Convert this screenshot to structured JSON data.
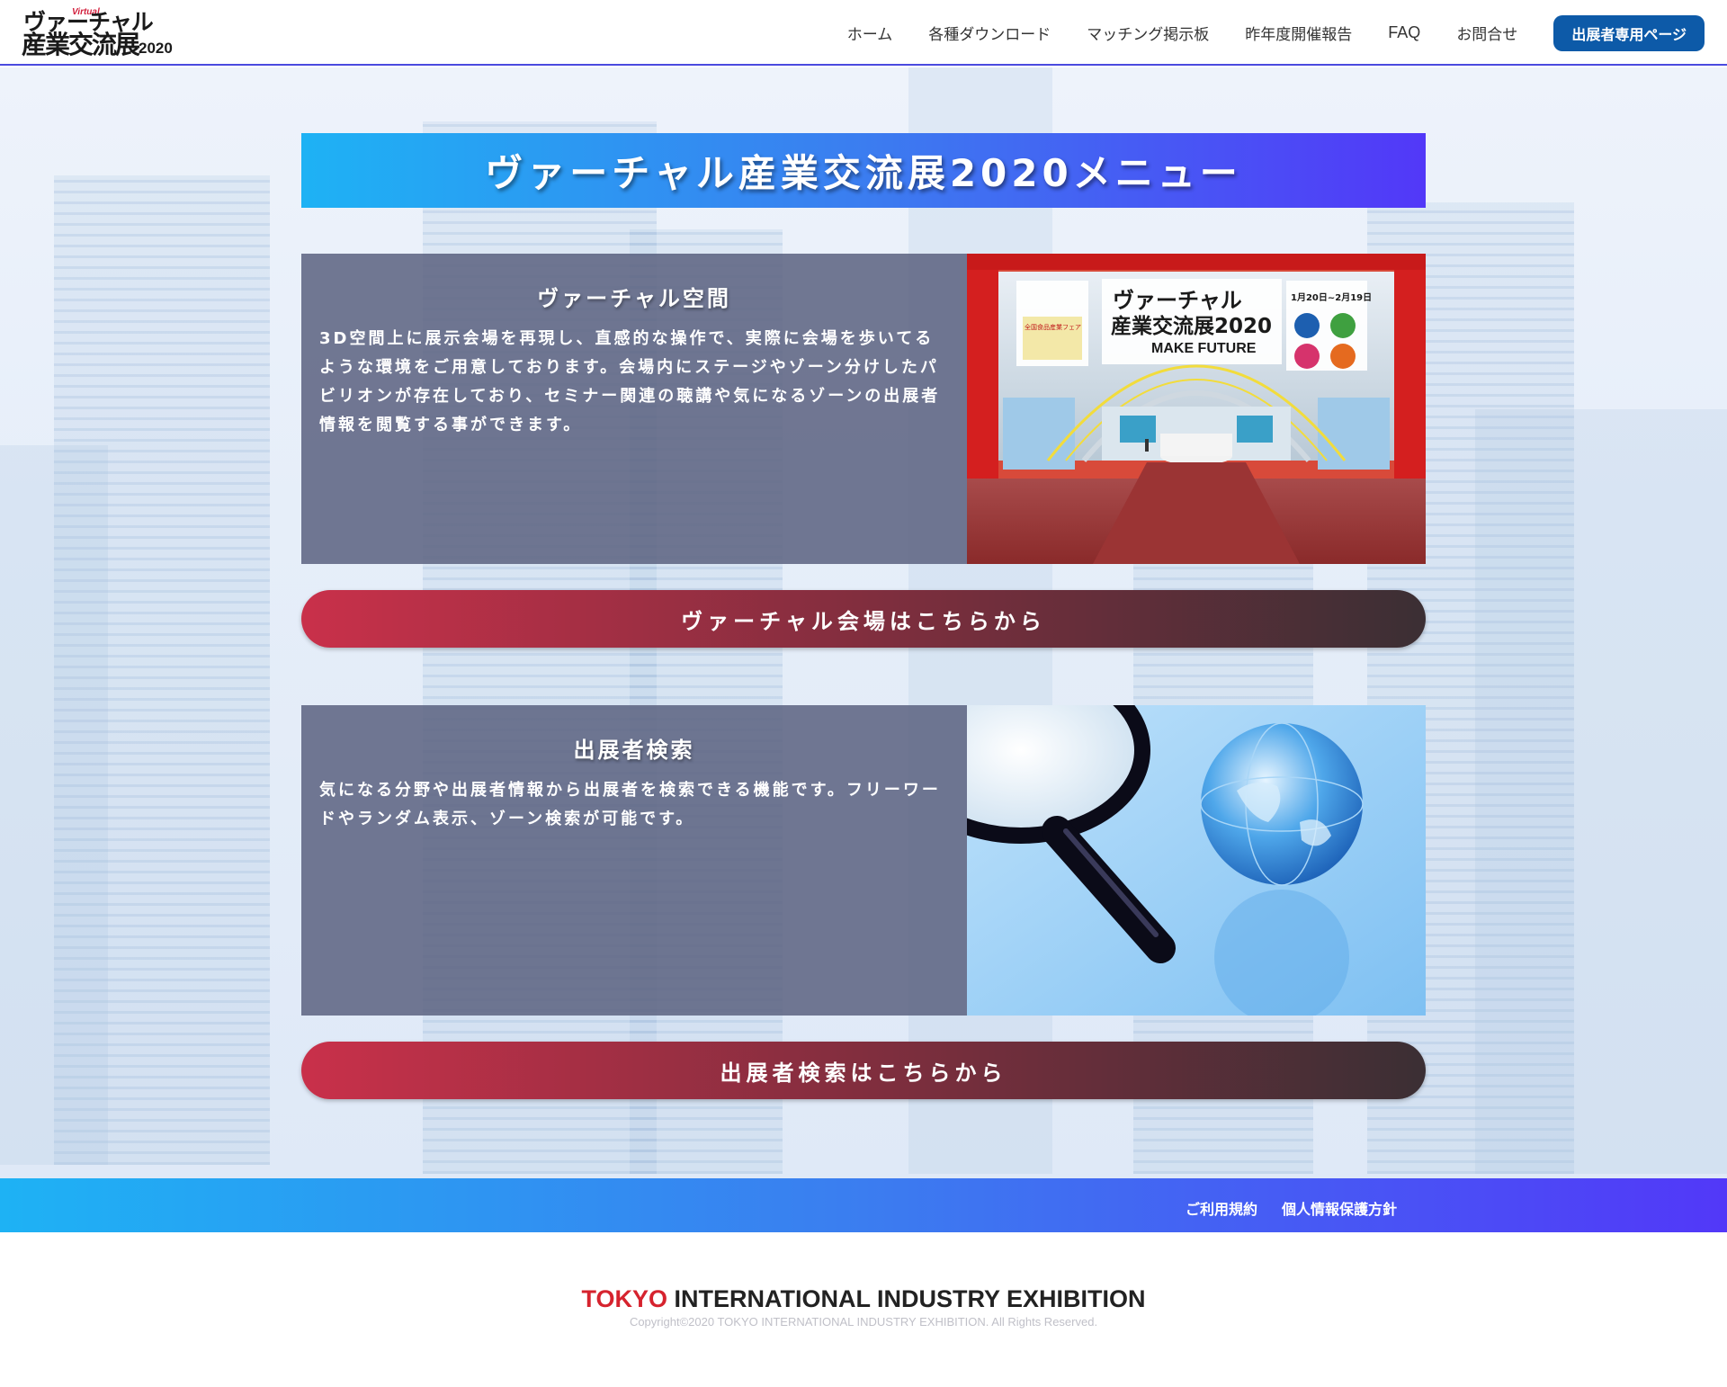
{
  "header": {
    "logo": {
      "virtual_tag": "Virtual",
      "line1": "ヴァーチャル",
      "line2": "産業交流展",
      "year": "2020"
    },
    "nav": [
      {
        "label": "ホーム"
      },
      {
        "label": "各種ダウンロード"
      },
      {
        "label": "マッチング掲示板"
      },
      {
        "label": "昨年度開催報告"
      },
      {
        "label": "FAQ"
      },
      {
        "label": "お問合せ"
      }
    ],
    "exhibitor_button": "出展者専用ページ"
  },
  "main": {
    "title": "ヴァーチャル産業交流展2020メニュー",
    "sections": [
      {
        "title": "ヴァーチャル空間",
        "desc": "3D空間上に展示会場を再現し、直感的な操作で、実際に会場を歩いてるような環境をご用意しております。会場内にステージやゾーン分けしたパビリオンが存在しており、セミナー関連の聴講や気になるゾーンの出展者情報を閲覧する事ができます。",
        "cta": "ヴァーチャル会場はこちらから",
        "image": {
          "sign_line1": "ヴァーチャル",
          "sign_line2": "産業交流展2020",
          "sign_make_future": "MAKE FUTURE",
          "sign_dates": "1月20日~2月19日",
          "sign_fair": "全国食品産業フェア"
        }
      },
      {
        "title": "出展者検索",
        "desc": "気になる分野や出展者情報から出展者を検索できる機能です。フリーワードやランダム表示、ゾーン検索が可能です。",
        "cta": "出展者検索はこちらから"
      }
    ]
  },
  "footer": {
    "links": [
      {
        "label": "ご利用規約"
      },
      {
        "label": "個人情報保護方針"
      }
    ],
    "logo_tokyo": "TOKYO",
    "logo_rest": " INTERNATIONAL INDUSTRY EXHIBITION",
    "copyright": "Copyright©2020 TOKYO INTERNATIONAL INDUSTRY EXHIBITION. All Rights Reserved."
  },
  "colors": {
    "header_accent": "#4a4adf",
    "exhibitor_button": "#0d5aa8",
    "banner_gradient": [
      "#1eb2f4",
      "#5238f8"
    ],
    "cta_gradient": [
      "#c9304a",
      "#3b2f34"
    ],
    "card_bg": "#5f6583",
    "footer_tokyo": "#d6232e"
  }
}
